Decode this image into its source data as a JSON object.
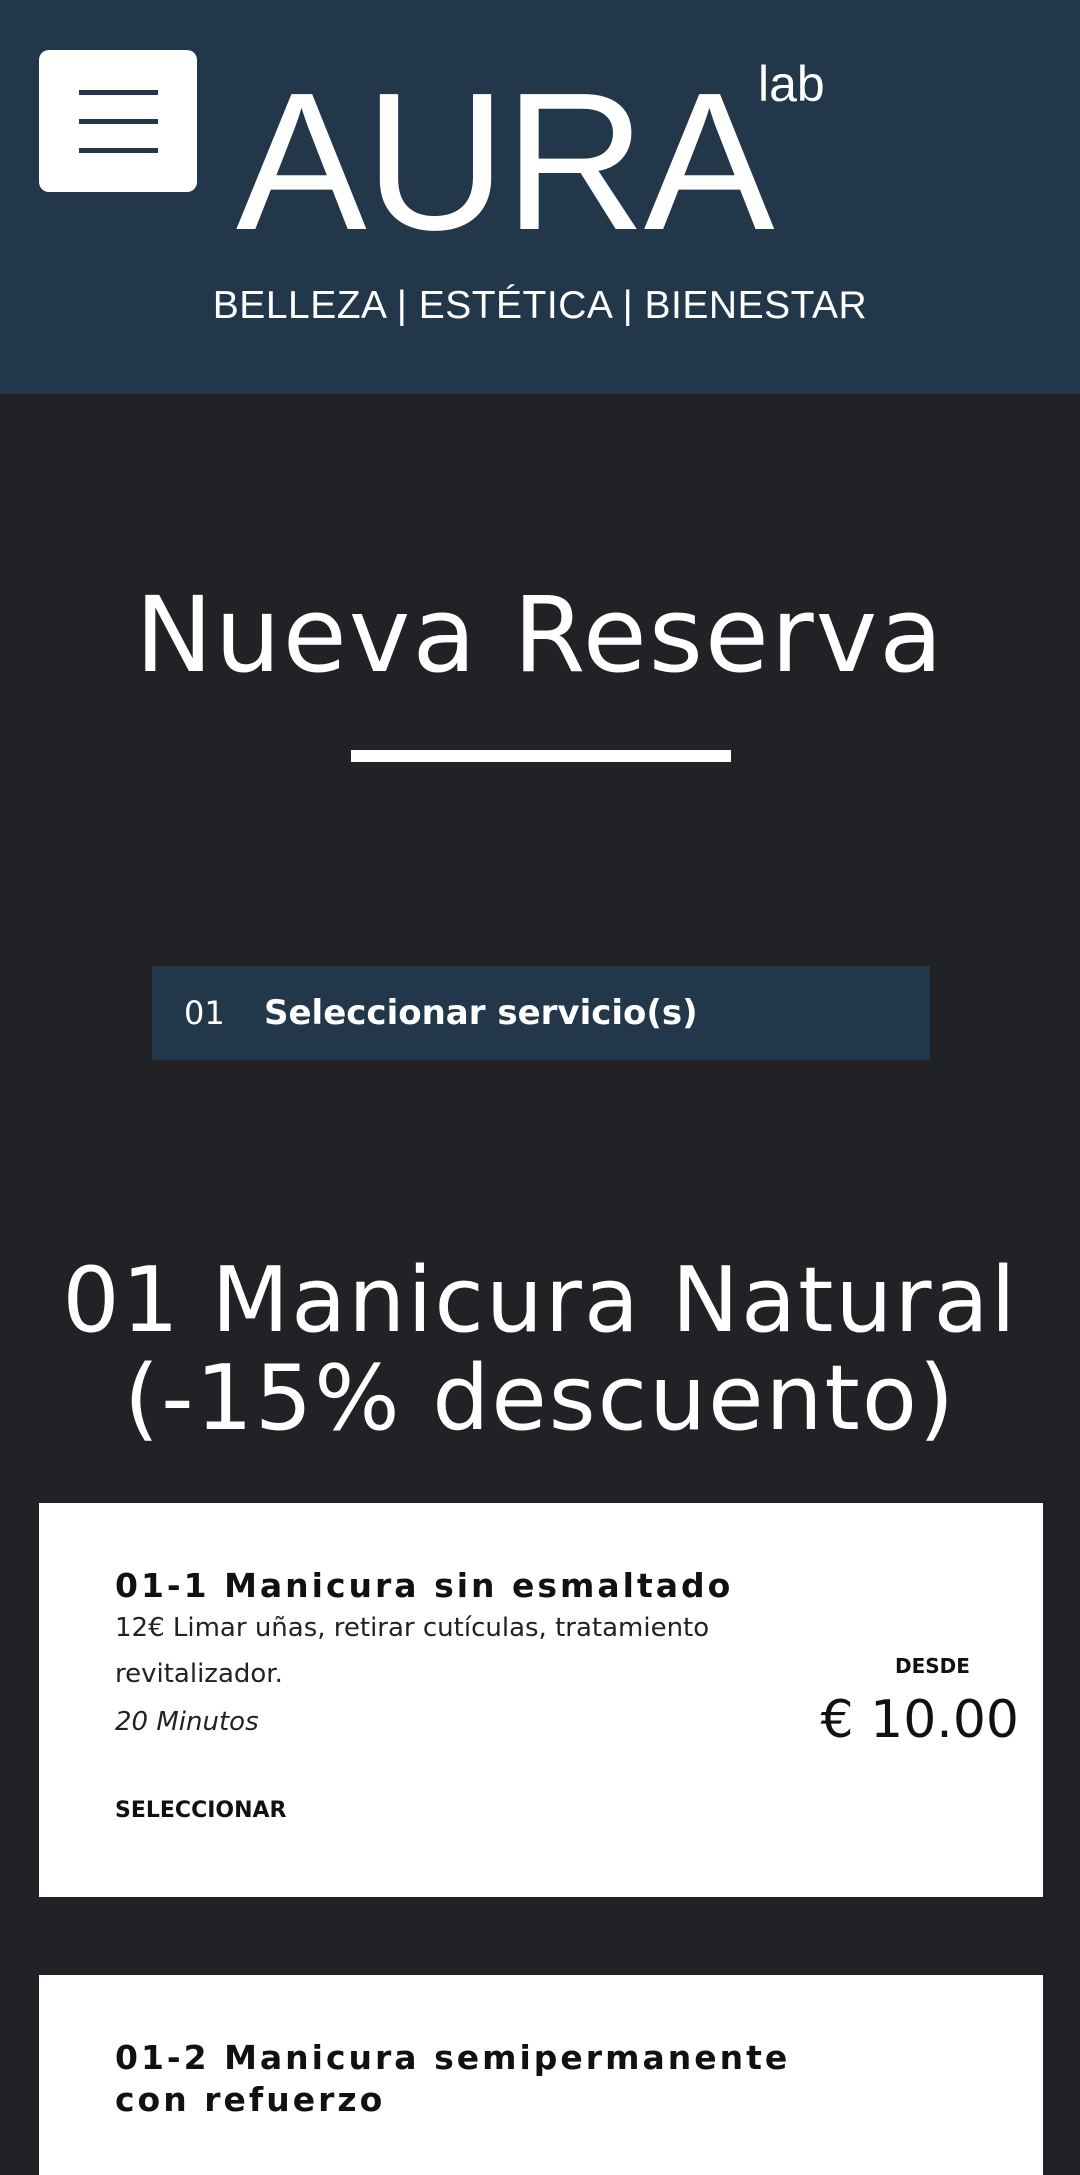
{
  "header": {
    "menu_icon": "hamburger-menu-icon",
    "logo": {
      "main": "AURA",
      "sup": "lab",
      "tagline": "BELLEZA | ESTÉTICA | BIENESTAR"
    },
    "background_color": "#22374a"
  },
  "page": {
    "title": "Nueva Reserva"
  },
  "step": {
    "number": "01",
    "label": "Seleccionar servicio(s)"
  },
  "category": {
    "title_line1": "01 Manicura Natural",
    "title_line2": "(-15% descuento)"
  },
  "services": [
    {
      "name": "01-1 Manicura sin esmaltado",
      "description": "12€ Limar uñas, retirar cutículas, tratamiento revitalizador.",
      "duration": "20 Minutos",
      "select_label": "SELECCIONAR",
      "price_from": "DESDE",
      "price": "€ 10.00"
    },
    {
      "name": "01-2 Manicura semipermanente con refuerzo"
    }
  ],
  "colors": {
    "page_background": "#202225",
    "accent": "#22374a",
    "card_background": "#ffffff"
  }
}
